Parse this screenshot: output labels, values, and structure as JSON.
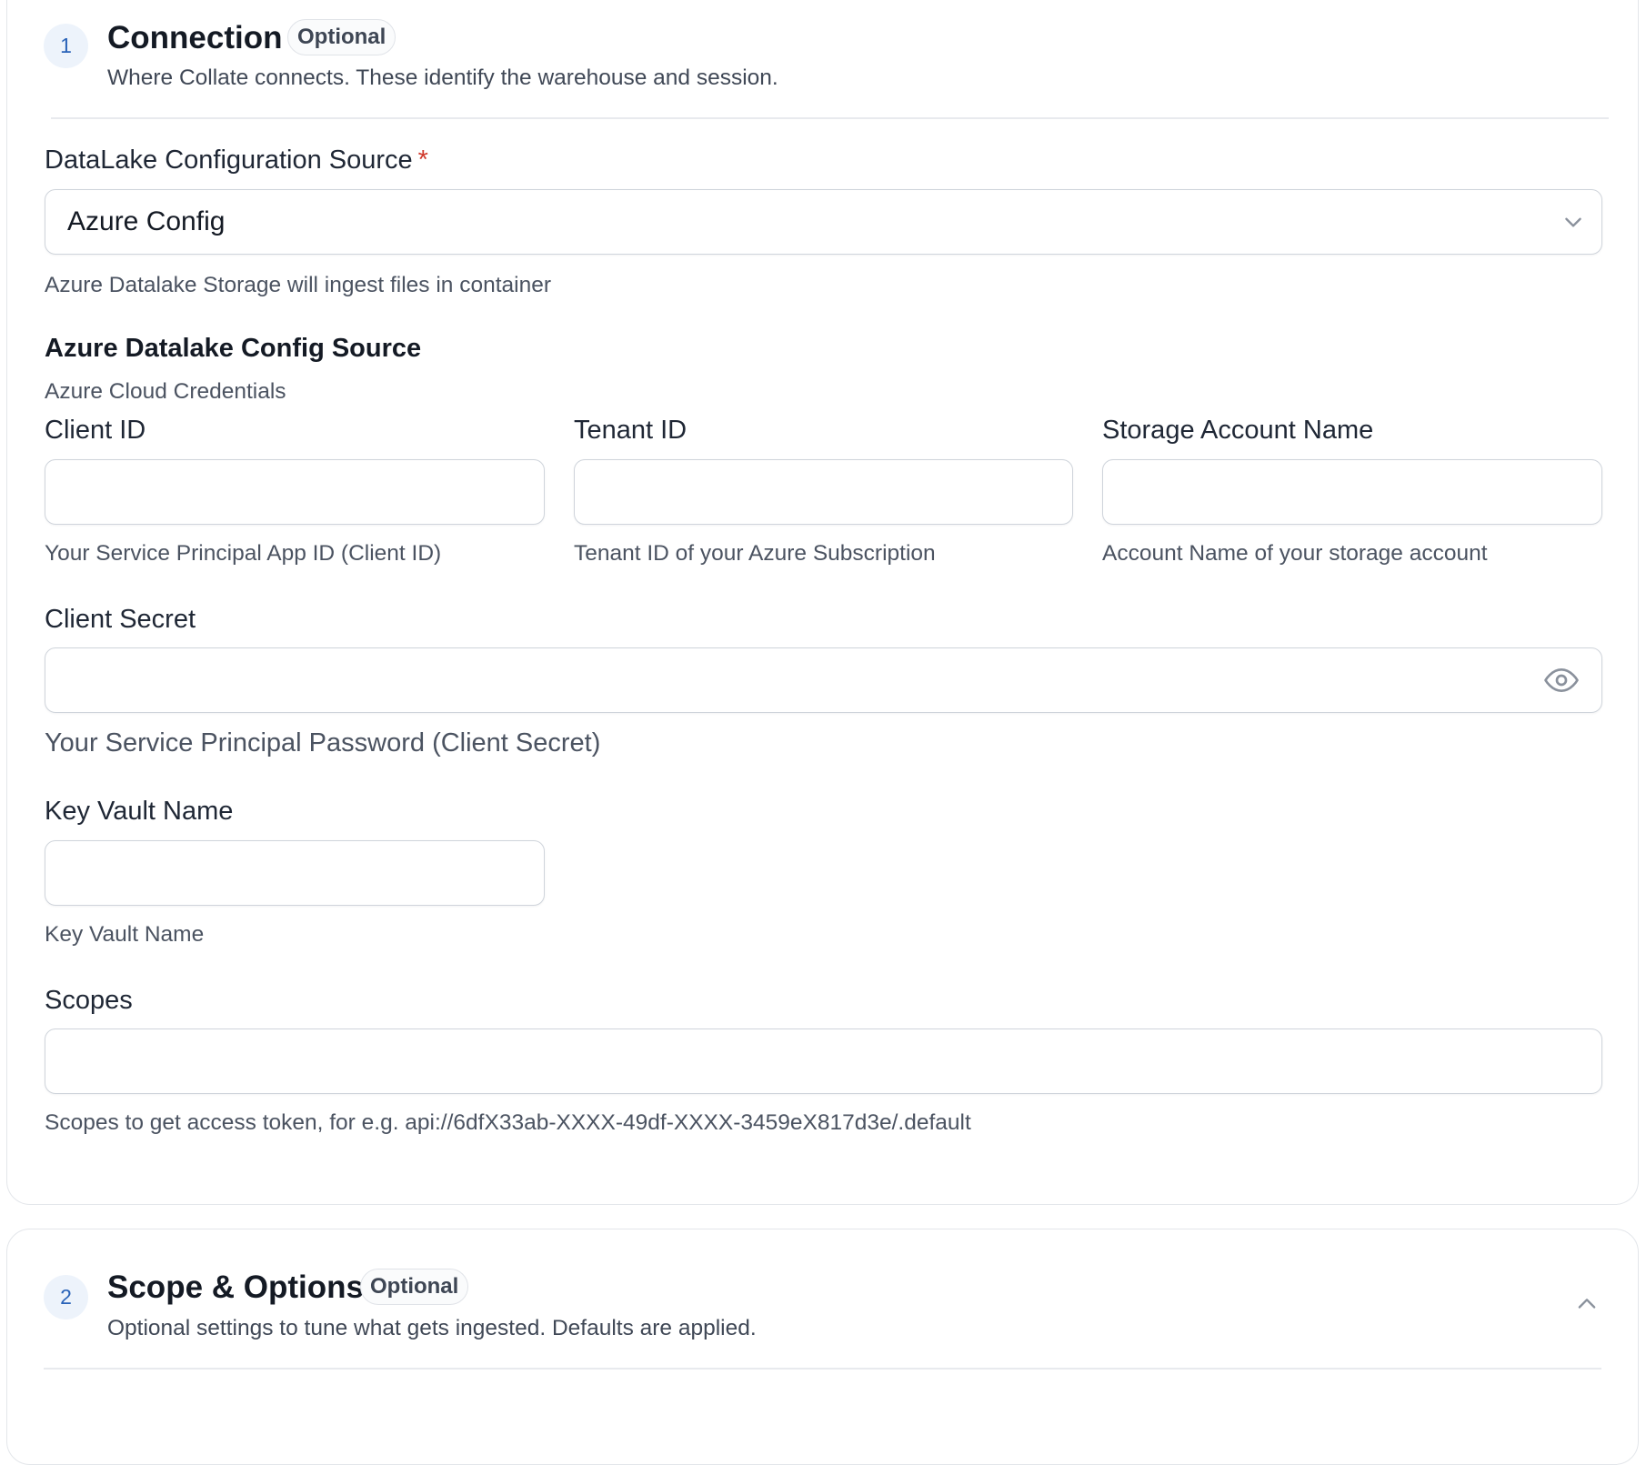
{
  "connection": {
    "step": "1",
    "title": "Connection",
    "badge": "Optional",
    "subtitle": "Where Collate connects. These identify the warehouse and session."
  },
  "datalake_source": {
    "label": "DataLake Configuration Source",
    "required_mark": "*",
    "value": "Azure Config",
    "help": "Azure Datalake Storage will ingest files in container"
  },
  "azure_section": {
    "title": "Azure Datalake Config Source",
    "subtitle": "Azure Cloud Credentials"
  },
  "fields": {
    "client_id": {
      "label": "Client ID",
      "value": "",
      "help": "Your Service Principal App ID (Client ID)"
    },
    "tenant_id": {
      "label": "Tenant ID",
      "value": "",
      "help": "Tenant ID of your Azure Subscription"
    },
    "storage_account_name": {
      "label": "Storage Account Name",
      "value": "",
      "help": "Account Name of your storage account"
    },
    "client_secret": {
      "label": "Client Secret",
      "value": "",
      "help": "Your Service Principal Password (Client Secret)",
      "icon": "eye-icon"
    },
    "key_vault_name": {
      "label": "Key Vault Name",
      "value": "",
      "help": "Key Vault Name"
    },
    "scopes": {
      "label": "Scopes",
      "value": "",
      "help": "Scopes to get access token, for e.g. api://6dfX33ab-XXXX-49df-XXXX-3459eX817d3e/.default"
    }
  },
  "scope_options": {
    "step": "2",
    "title": "Scope & Options",
    "badge": "Optional",
    "subtitle": "Optional settings to tune what gets ingested. Defaults are applied.",
    "icon": "chevron-up-icon"
  },
  "colors": {
    "accent": "#2a63b8",
    "required": "#d0392b",
    "border": "#cfd4db"
  }
}
